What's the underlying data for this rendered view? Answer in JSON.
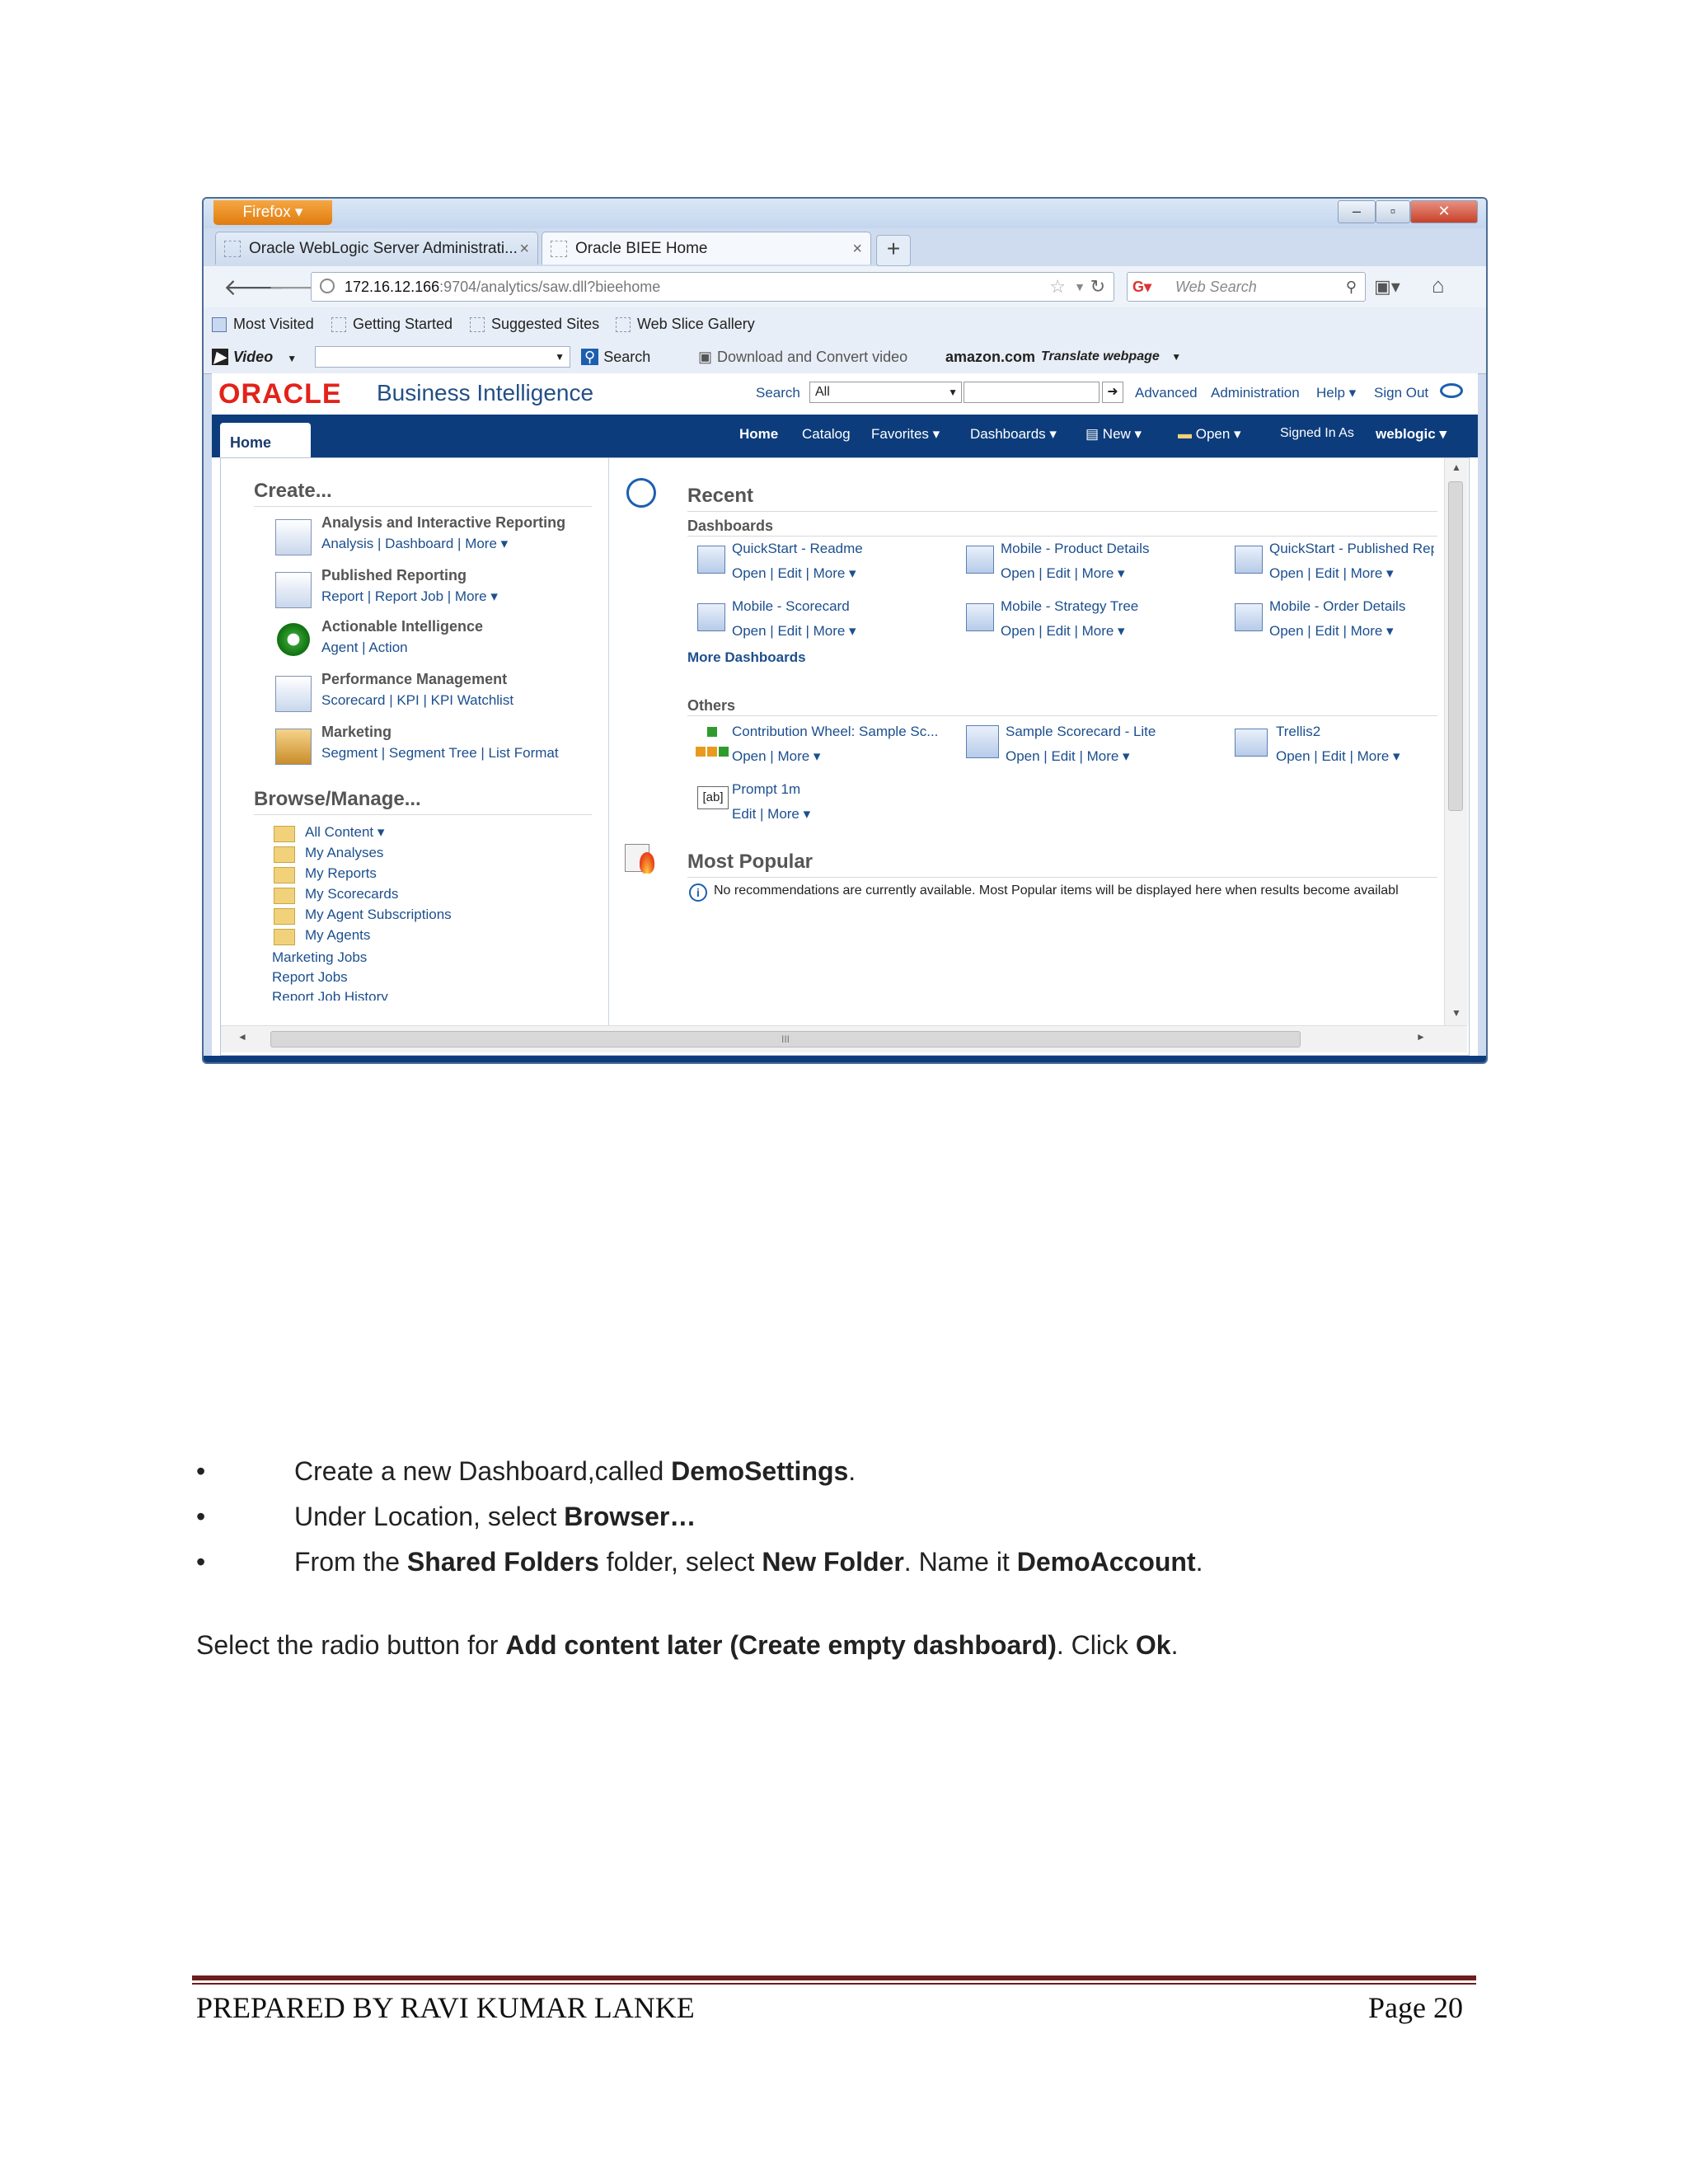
{
  "browser": {
    "app_button": "Firefox ▾",
    "tabs": [
      {
        "label": "Oracle WebLogic Server Administrati...",
        "close": "×"
      },
      {
        "label": "Oracle BIEE Home",
        "close": "×"
      }
    ],
    "new_tab": "+",
    "url_host": "172.16.12.166",
    "url_path": ":9704/analytics/saw.dll?bieehome",
    "web_search_placeholder": "Web Search",
    "bookmarks": [
      "Most Visited",
      "Getting Started",
      "Suggested Sites",
      "Web Slice Gallery"
    ],
    "toolbar": {
      "video": "Video",
      "search": "Search",
      "download": "Download and Convert video",
      "amazon": "amazon.com",
      "translate": "Translate webpage"
    }
  },
  "obiee": {
    "logo": "ORACLE",
    "title": "Business Intelligence",
    "search_label": "Search",
    "search_scope": "All",
    "header_links": [
      "Advanced",
      "Administration",
      "Help ▾",
      "Sign Out"
    ],
    "home_tab": "Home",
    "nav": [
      "Home",
      "Catalog",
      "Favorites ▾",
      "Dashboards ▾",
      "New ▾",
      "Open ▾",
      "Signed In As",
      "weblogic ▾"
    ],
    "create": {
      "heading": "Create...",
      "items": [
        {
          "title": "Analysis and Interactive Reporting",
          "links": "Analysis | Dashboard | More ▾"
        },
        {
          "title": "Published Reporting",
          "links": "Report | Report Job | More ▾"
        },
        {
          "title": "Actionable Intelligence",
          "links": "Agent | Action"
        },
        {
          "title": "Performance Management",
          "links": "Scorecard | KPI | KPI Watchlist"
        },
        {
          "title": "Marketing",
          "links": "Segment | Segment Tree | List Format"
        }
      ]
    },
    "browse": {
      "heading": "Browse/Manage...",
      "items": [
        "All Content ▾",
        "My Analyses",
        "My Reports",
        "My Scorecards",
        "My Agent Subscriptions",
        "My Agents"
      ],
      "extra": [
        "Marketing Jobs",
        "Report Jobs",
        "Report Job History"
      ]
    },
    "recent": {
      "heading": "Recent",
      "dashboards_label": "Dashboards",
      "dashboards": [
        {
          "title": "QuickStart - Readme",
          "links": "Open | Edit | More ▾"
        },
        {
          "title": "Mobile - Product Details",
          "links": "Open | Edit | More ▾"
        },
        {
          "title": "QuickStart - Published Rep",
          "links": "Open | Edit | More ▾"
        },
        {
          "title": "Mobile - Scorecard",
          "links": "Open | Edit | More ▾"
        },
        {
          "title": "Mobile - Strategy Tree",
          "links": "Open | Edit | More ▾"
        },
        {
          "title": "Mobile - Order Details",
          "links": "Open | Edit | More ▾"
        }
      ],
      "more_dashboards": "More Dashboards",
      "others_label": "Others",
      "others": [
        {
          "title": "Contribution Wheel: Sample Sc...",
          "links": "Open | More ▾"
        },
        {
          "title": "Sample Scorecard - Lite",
          "links": "Open | Edit | More ▾"
        },
        {
          "title": "Trellis2",
          "links": "Open | Edit | More ▾"
        },
        {
          "title": "Prompt 1m",
          "links": "Edit | More ▾",
          "icon_text": "[ab]"
        }
      ]
    },
    "popular": {
      "heading": "Most Popular",
      "message": "No recommendations are currently available. Most Popular items will be displayed here when results become availabl"
    },
    "hscroll_grip": "III"
  },
  "document": {
    "bullets": [
      {
        "pre": "Create a new Dashboard,called ",
        "bold": "DemoSettings",
        "post": "."
      },
      {
        "pre": "Under Location, select ",
        "bold": "Browser…",
        "post": ""
      },
      {
        "pre": "From the ",
        "bold": "Shared Folders",
        "mid": " folder, select ",
        "bold2": "New Folder",
        "mid2": ". Name it ",
        "bold3": "DemoAccount",
        "post": "."
      }
    ],
    "paragraph": {
      "pre": "Select the radio button for ",
      "bold": "Add content later (Create empty dashboard)",
      "mid": ". Click ",
      "bold2": "Ok",
      "post": "."
    },
    "footer_left": "PREPARED BY RAVI KUMAR LANKE",
    "footer_right": "Page 20"
  }
}
